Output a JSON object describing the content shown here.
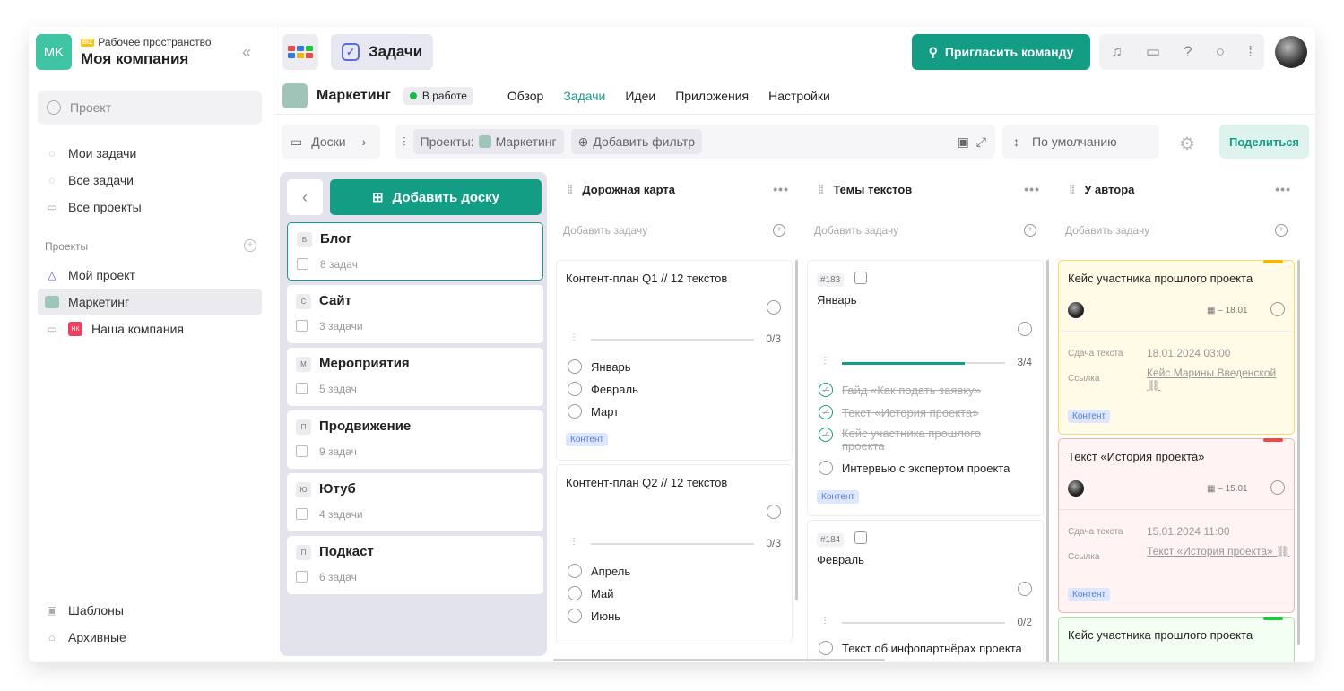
{
  "sidebar": {
    "ws_logo": "MK",
    "ws_badge": "BIZ",
    "ws_sub": "Рабочее пространство",
    "ws_name": "Моя компания",
    "search_placeholder": "Проект",
    "nav": [
      "Мои задачи",
      "Все задачи",
      "Все проекты"
    ],
    "projects_header": "Проекты",
    "projects": [
      "Мой проект",
      "Маркетинг",
      "Наша компания"
    ],
    "hk": "НК",
    "bottom": [
      "Шаблоны",
      "Архивные"
    ]
  },
  "top": {
    "crumb": "Задачи",
    "invite": "Пригласить команду"
  },
  "project": {
    "name": "Маркетинг",
    "status": "В работе",
    "tabs": [
      "Обзор",
      "Задачи",
      "Идеи",
      "Приложения",
      "Настройки"
    ]
  },
  "toolbar": {
    "boards": "Доски",
    "projects_label": "Проекты:",
    "project_chip": "Маркетинг",
    "add_filter": "Добавить фильтр",
    "sort": "По умолчанию",
    "share": "Поделиться"
  },
  "boards": {
    "add": "Добавить доску",
    "items": [
      {
        "letter": "Б",
        "name": "Блог",
        "count": "8 задач"
      },
      {
        "letter": "С",
        "name": "Сайт",
        "count": "3 задачи"
      },
      {
        "letter": "М",
        "name": "Мероприятия",
        "count": "5 задач"
      },
      {
        "letter": "П",
        "name": "Продвижение",
        "count": "9 задач"
      },
      {
        "letter": "Ю",
        "name": "Ютуб",
        "count": "4 задачи"
      },
      {
        "letter": "П",
        "name": "Подкаст",
        "count": "6 задач"
      }
    ]
  },
  "columns": {
    "add_task": "Добавить задачу",
    "c1": {
      "title": "Дорожная карта",
      "cards": [
        {
          "title": "Контент-план Q1 // 12 текстов",
          "progress": "0/3",
          "subs": [
            "Январь",
            "Февраль",
            "Март"
          ],
          "tag": "Контент"
        },
        {
          "title": "Контент-план Q2 // 12 текстов",
          "progress": "0/3",
          "subs": [
            "Апрель",
            "Май",
            "Июнь"
          ]
        }
      ]
    },
    "c2": {
      "title": "Темы текстов",
      "cards": [
        {
          "num": "#183",
          "title": "Январь",
          "progress": "3/4",
          "progress_value": 0.75,
          "subs_done": [
            "Гайд «Как подать заявку»",
            "Текст «История проекта»",
            "Кейс участника прошлого проекта"
          ],
          "subs": [
            "Интервью с экспертом проекта"
          ],
          "tag": "Контент"
        },
        {
          "num": "#184",
          "title": "Февраль",
          "progress": "0/2",
          "subs": [
            "Текст об инфопартнёрах проекта"
          ]
        }
      ]
    },
    "c3": {
      "title": "У автора",
      "field_due": "Сдача текста",
      "field_link": "Ссылка",
      "cards": [
        {
          "title": "Кейс участника прошлого проекта",
          "date": "18.01",
          "due": "18.01.2024 03:00",
          "link": "Кейс Марины Введенской",
          "tag": "Контент",
          "bg": "#fffbe6",
          "border": "#f2dc6a",
          "bar": "#f5b800"
        },
        {
          "title": "Текст «История проекта»",
          "date": "15.01",
          "due": "15.01.2024 11:00",
          "link": "Текст «История проекта»",
          "tag": "Контент",
          "bg": "#fff3f3",
          "border": "#f0b0b0",
          "bar": "#f04848"
        },
        {
          "title": "Кейс участника прошлого проекта",
          "bg": "#f3fff3",
          "border": "#a8e0a8",
          "bar": "#1ccb3c"
        }
      ]
    }
  }
}
